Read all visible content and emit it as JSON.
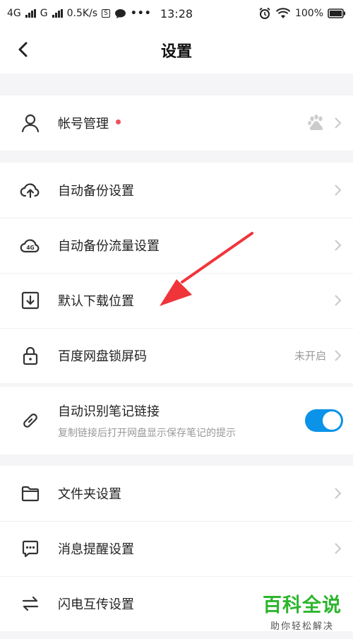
{
  "status": {
    "network1": "4G",
    "network2": "G",
    "speed": "0.5K/s",
    "time": "13:28",
    "battery": "100%",
    "s_box": "S",
    "more": "•••"
  },
  "nav": {
    "title": "设置",
    "back_icon": "chevron-left-icon"
  },
  "items": {
    "account": {
      "label": "帐号管理",
      "icon": "user-icon",
      "badge_color": "#f0505b"
    },
    "auto_backup": {
      "label": "自动备份设置",
      "icon": "cloud-upload-icon"
    },
    "backup_traffic": {
      "label": "自动备份流量设置",
      "icon": "cloud-4g-icon",
      "icon_text": "4G"
    },
    "download_location": {
      "label": "默认下载位置",
      "icon": "download-icon"
    },
    "lock_code": {
      "label": "百度网盘锁屏码",
      "icon": "lock-icon",
      "value": "未开启"
    },
    "note_links": {
      "label": "自动识别笔记链接",
      "sub": "复制链接后打开网盘显示保存笔记的提示",
      "icon": "link-icon",
      "enabled": true
    },
    "folder": {
      "label": "文件夹设置",
      "icon": "folder-icon"
    },
    "reminders": {
      "label": "消息提醒设置",
      "icon": "message-icon"
    },
    "transfer": {
      "label": "闪电互传设置",
      "icon": "transfer-icon"
    }
  },
  "colors": {
    "toggle_on": "#0a93e9",
    "arrow": "#f0353a",
    "watermark": "#2db52e"
  },
  "watermark": {
    "title": "百科全说",
    "subtitle": "助你轻松解决"
  }
}
